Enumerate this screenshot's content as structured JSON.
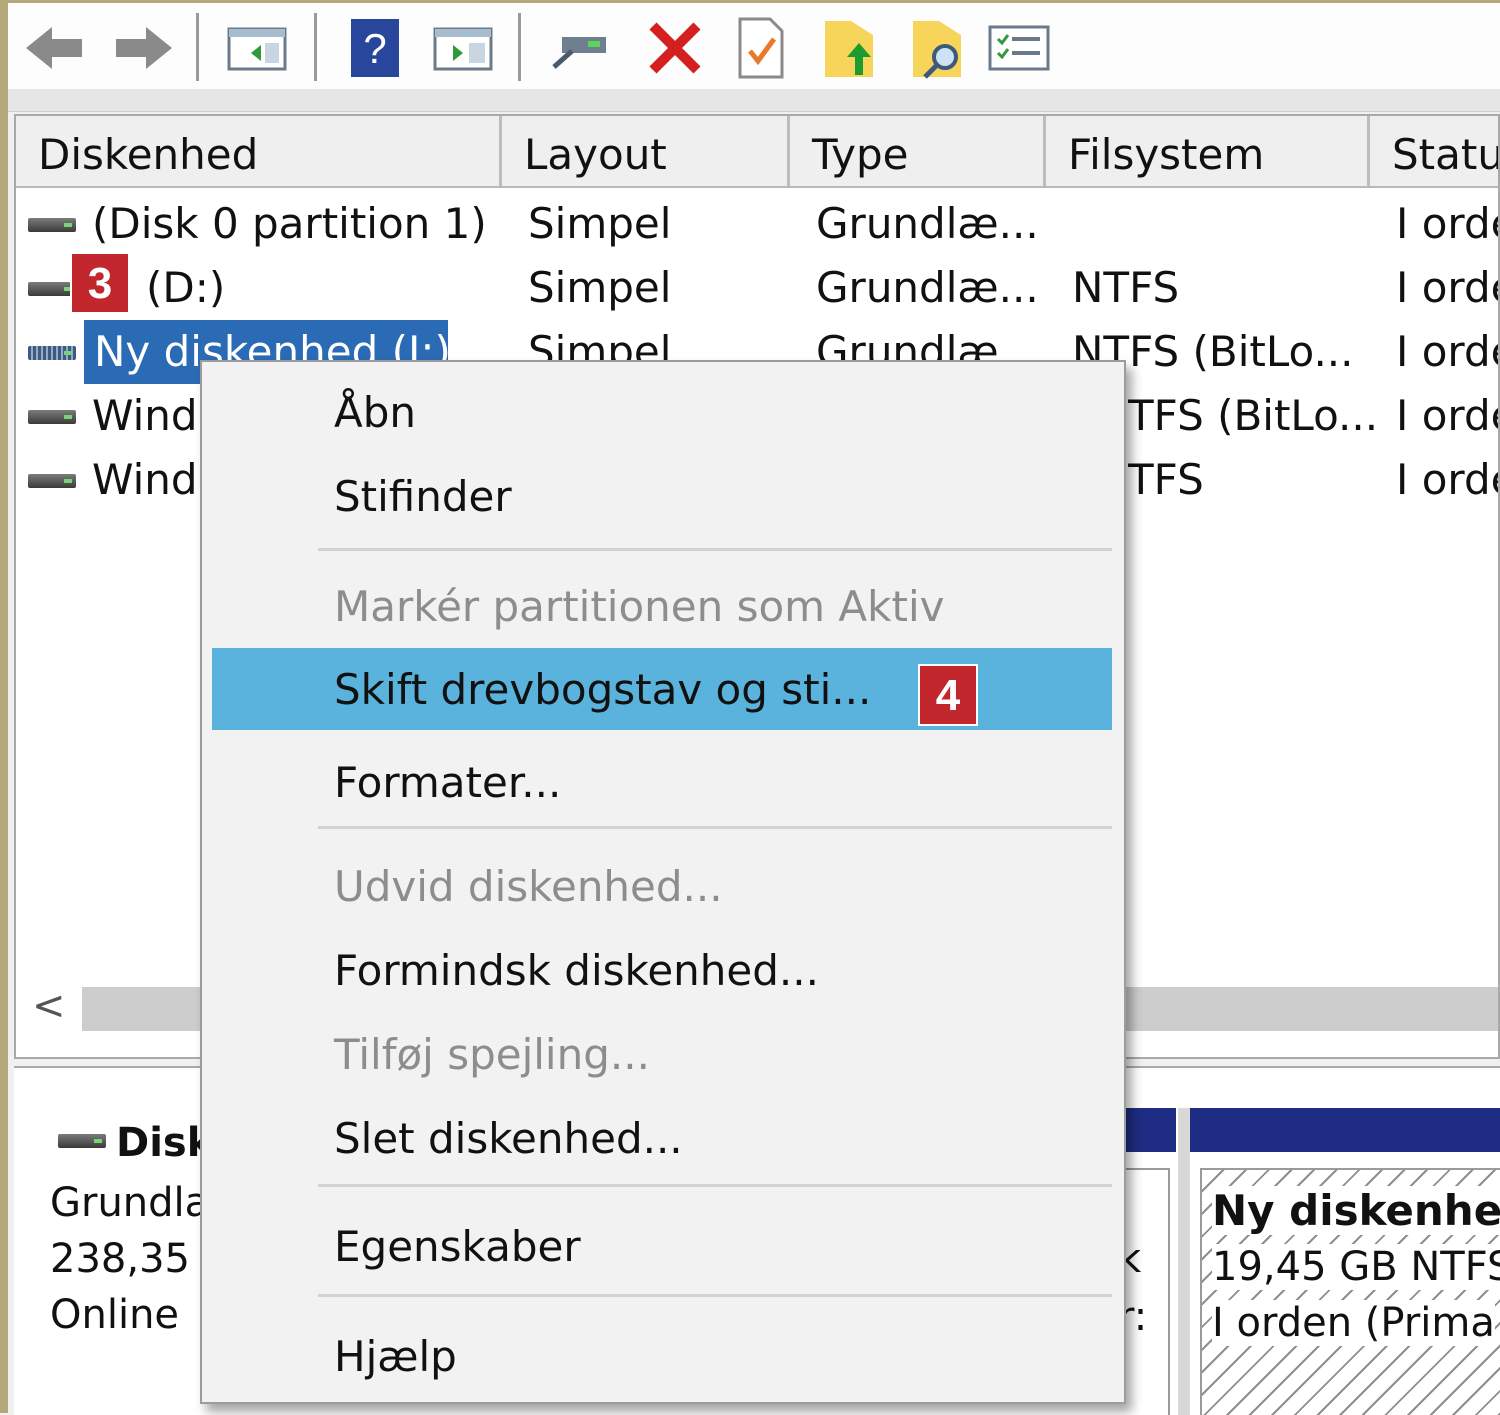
{
  "toolbar": {
    "icons": [
      "back-arrow-icon",
      "forward-arrow-icon",
      "show-hide-tree-icon",
      "help-icon",
      "show-hide-action-pane-icon",
      "connect-drive-icon",
      "delete-icon",
      "check-disk-icon",
      "folder-up-icon",
      "folder-search-icon",
      "properties-list-icon"
    ]
  },
  "columns": [
    "Diskenhed",
    "Layout",
    "Type",
    "Filsystem",
    "Statu"
  ],
  "rows": [
    {
      "name": "(Disk 0 partition 1)",
      "layout": "Simpel",
      "type": "Grundlæ...",
      "fs": "",
      "status": "I orde"
    },
    {
      "name": "(D:)",
      "layout": "Simpel",
      "type": "Grundlæ...",
      "fs": "NTFS",
      "status": "I orde"
    },
    {
      "name": "Ny diskenhed (I:)",
      "layout": "Simpel",
      "type": "Grundlæ...",
      "fs": "NTFS (BitLo...",
      "status": "I orde"
    },
    {
      "name": "Wind",
      "layout": "",
      "type": "",
      "fs": "TFS (BitLo...",
      "status": "I orde"
    },
    {
      "name": "Wind",
      "layout": "",
      "type": "",
      "fs": "TFS",
      "status": "I orde"
    }
  ],
  "badges": {
    "step3": "3",
    "step4": "4"
  },
  "scroll_left": "<",
  "disk_panel": {
    "title": "Disk",
    "line1": "Grundla",
    "line2": "238,35 (",
    "line3": "Online",
    "partial1": "k",
    "partial2": "r:",
    "vol_title": "Ny diskenhed",
    "vol_size": "19,45 GB NTFS",
    "vol_status": "I orden (Prima"
  },
  "context_menu": {
    "items": [
      {
        "label": "Åbn",
        "state": "enabled"
      },
      {
        "label": "Stifinder",
        "state": "enabled"
      },
      {
        "label": "Markér partitionen som Aktiv",
        "state": "disabled"
      },
      {
        "label": "Skift drevbogstav og sti...",
        "state": "highlighted"
      },
      {
        "label": "Formater...",
        "state": "enabled"
      },
      {
        "label": "Udvid diskenhed...",
        "state": "disabled"
      },
      {
        "label": "Formindsk diskenhed...",
        "state": "enabled"
      },
      {
        "label": "Tilføj spejling...",
        "state": "disabled"
      },
      {
        "label": "Slet diskenhed...",
        "state": "enabled"
      },
      {
        "label": "Egenskaber",
        "state": "enabled"
      },
      {
        "label": "Hjælp",
        "state": "enabled"
      }
    ]
  },
  "colors": {
    "selection": "#2b6ab5",
    "menu_highlight": "#5ab3dc",
    "badge": "#c1272d",
    "volume_bar": "#1e2d83"
  }
}
